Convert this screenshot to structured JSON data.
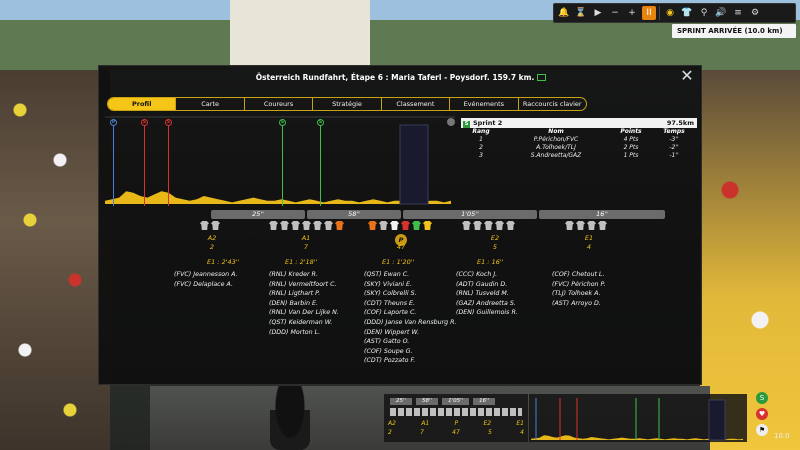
{
  "hud": {
    "buttons": [
      {
        "icon": "bell-icon",
        "glyph": "🔔"
      },
      {
        "icon": "hourglass-icon",
        "glyph": "⌛"
      },
      {
        "icon": "play-icon",
        "glyph": "▶"
      },
      {
        "icon": "minus-icon",
        "glyph": "−"
      },
      {
        "icon": "plus-icon",
        "glyph": "+"
      },
      {
        "icon": "pause-icon",
        "glyph": "II"
      },
      {
        "icon": "eye-icon",
        "glyph": "◉"
      },
      {
        "icon": "jersey-icon",
        "glyph": "👕"
      },
      {
        "icon": "bike-icon",
        "glyph": "⚲"
      },
      {
        "icon": "sound-icon",
        "glyph": "🔊"
      },
      {
        "icon": "menu-icon",
        "glyph": "≡"
      },
      {
        "icon": "gear-icon",
        "glyph": "⚙"
      }
    ],
    "sprint_badge": "SPRINT ARRIVÉE (10.0 km)"
  },
  "modal": {
    "title": "Österreich Rundfahrt, Étape 6 : Maria Taferl - Poysdorf. 159.7 km.",
    "close": "✕",
    "tabs": [
      "Profil",
      "Carte",
      "Coureurs",
      "Stratégie",
      "Classement",
      "Evénements",
      "Raccourcis clavier"
    ],
    "active_tab": "Profil"
  },
  "profile": {
    "markers": [
      {
        "label": "P",
        "color": "#4b7fd6"
      },
      {
        "label": "S",
        "color": "#d8322e"
      },
      {
        "label": "S",
        "color": "#d8322e"
      },
      {
        "label": "S",
        "color": "#3fbf4a"
      },
      {
        "label": "S",
        "color": "#3fbf4a"
      }
    ],
    "elevation": [
      30,
      31,
      32,
      36,
      35,
      33,
      32,
      34,
      36,
      35,
      32,
      31,
      30,
      31,
      33,
      32,
      31,
      30,
      29,
      30,
      31,
      32,
      31,
      30,
      30,
      31,
      30,
      29,
      30,
      31,
      30,
      29,
      30,
      31,
      30,
      30,
      29,
      30,
      31,
      30,
      29,
      30,
      30,
      31,
      30,
      29,
      30,
      30,
      29,
      30
    ]
  },
  "sprint": {
    "title": "Sprint 2",
    "distance": "97.5km",
    "headers": {
      "rank": "Rang",
      "name": "Nom",
      "points": "Points",
      "time": "Temps"
    },
    "rows": [
      {
        "rank": "1",
        "name": "P.Périchon/FVC",
        "points": "4 Pts",
        "time": "-3''"
      },
      {
        "rank": "2",
        "name": "A.Tolhoek/TLJ",
        "points": "2 Pts",
        "time": "-2''"
      },
      {
        "rank": "3",
        "name": "S.Andreetta/GAZ",
        "points": "1 Pts",
        "time": "-1''"
      }
    ]
  },
  "gaps": [
    "25''",
    "58''",
    "1'05''",
    "16''"
  ],
  "groups": [
    {
      "label": "A2",
      "count": "2",
      "gap": "E1 : 2'43''",
      "jerseys": [
        "#bfbfbf",
        "#bfbfbf"
      ]
    },
    {
      "label": "A1",
      "count": "7",
      "gap": "E1 : 2'18''",
      "jerseys": [
        "#bfbfbf",
        "#bfbfbf",
        "#bfbfbf",
        "#bfbfbf",
        "#bfbfbf",
        "#bfbfbf",
        "#e8731a"
      ]
    },
    {
      "label": "P",
      "count": "47",
      "gap": "E1 : 1'20''",
      "jerseys": [
        "#e8731a",
        "#bfbfbf",
        "#f2f2f2",
        "#d8322e",
        "#3fbf4a",
        "#f2c31a"
      ]
    },
    {
      "label": "E2",
      "count": "5",
      "gap": "E1 : 16''",
      "jerseys": [
        "#bfbfbf",
        "#bfbfbf",
        "#bfbfbf",
        "#bfbfbf",
        "#bfbfbf"
      ]
    },
    {
      "label": "E1",
      "count": "4",
      "gap": "",
      "jerseys": [
        "#bfbfbf",
        "#bfbfbf",
        "#bfbfbf",
        "#bfbfbf"
      ]
    }
  ],
  "riders": {
    "a2": [
      "(FVC) Jeannesson A.",
      "(FVC) Delaplace A."
    ],
    "a1": [
      "(RNL) Kreder R.",
      "(RNL) Vermeltfoort C.",
      "(RNL) Ligthart P.",
      "(DEN) Barbin E.",
      "(RNL) Van Der Lijke N.",
      "(QST) Keiderman W.",
      "(DDD) Morton L."
    ],
    "p": [
      "(QST) Ewan C.",
      "(SKY) Viviani E.",
      "(SKY) Colbrelli S.",
      "(CDT) Theuns E.",
      "(COF) Laporte C.",
      "(DDD) Janse Van Rensburg R.",
      "(DEN) Wippert W.",
      "(AST) Gatto O.",
      "(COF) Soupe G.",
      "(CDT) Pozzato F."
    ],
    "e2": [
      "(CCC) Koch J.",
      "(ADT) Gaudin D.",
      "(RNL) Tusveld M.",
      "(GAZ) Andreetta S.",
      "(DEN) Guillemois R."
    ],
    "e1": [
      "(COF) Chetout L.",
      "(FVC) Périchon P.",
      "(TLJ) Tolhoek A.",
      "(AST) Arroyo D."
    ]
  },
  "mini": {
    "gaps": [
      "25''",
      "58''",
      "1'05''",
      "16''"
    ],
    "labels": [
      "A2",
      "A1",
      "P",
      "E2",
      "E1"
    ],
    "counts": [
      "2",
      "7",
      "47",
      "5",
      "4"
    ],
    "distance": "10.0"
  }
}
